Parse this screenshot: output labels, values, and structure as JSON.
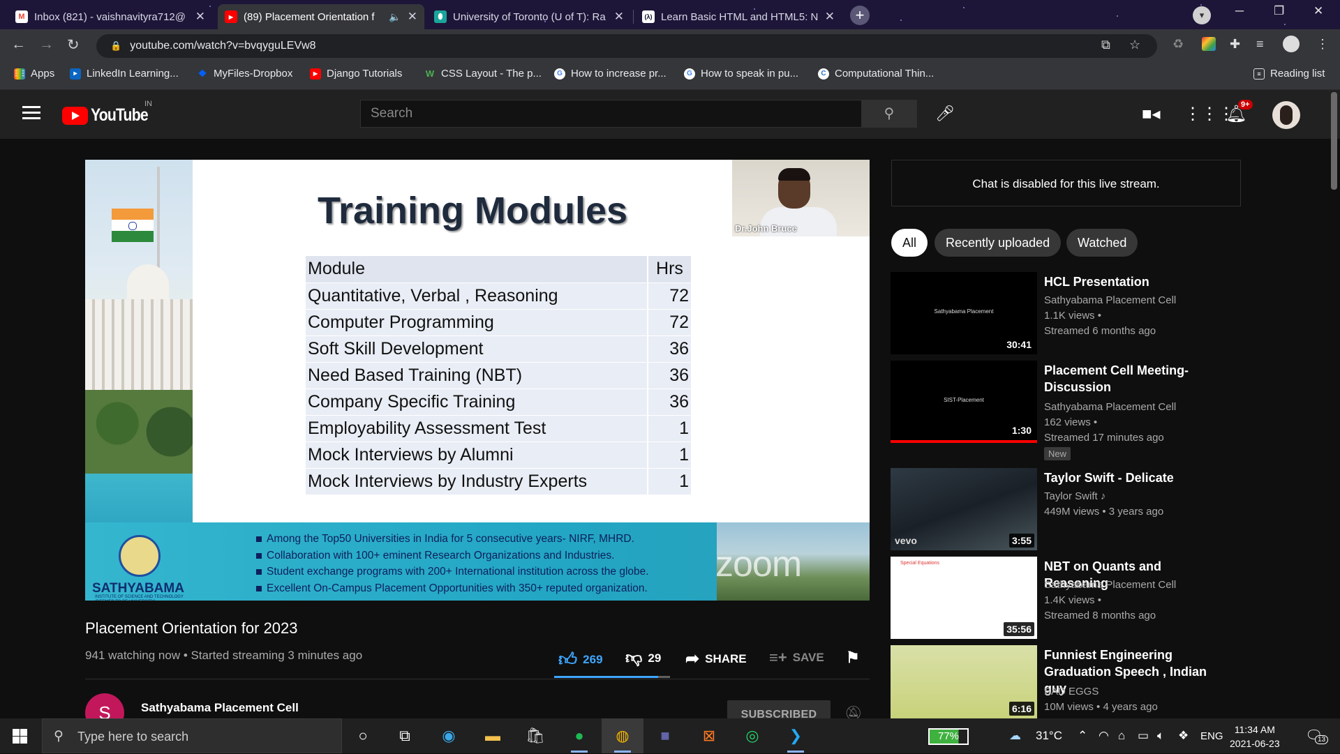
{
  "browser": {
    "tabs": [
      {
        "label": "Inbox (821) - vaishnavityra712@",
        "icon": "gmail-icon"
      },
      {
        "label": "(89) Placement Orientation f",
        "icon": "youtube-icon",
        "active": true
      },
      {
        "label": "University of Toronto (U of T): Ra",
        "icon": "bookmark-icon"
      },
      {
        "label": "Learn Basic HTML and HTML5: N",
        "icon": "fcc-icon"
      }
    ],
    "url": "youtube.com/watch?v=bvqyguLEVw8",
    "bookmarks": [
      {
        "label": "Apps",
        "icon": "apps-grid-icon",
        "color": "#4285f4"
      },
      {
        "label": "LinkedIn Learning...",
        "icon": "linkedin-learning-icon",
        "color": "#0a66c2"
      },
      {
        "label": "MyFiles-Dropbox",
        "icon": "dropbox-icon",
        "color": "#0061fe"
      },
      {
        "label": "Django Tutorials",
        "icon": "youtube-icon",
        "color": "#ff0000"
      },
      {
        "label": "CSS Layout - The p...",
        "icon": "w3-icon",
        "color": "#4caf50"
      },
      {
        "label": "How to increase pr...",
        "icon": "google-icon",
        "color": "#ffffff"
      },
      {
        "label": "How to speak in pu...",
        "icon": "google-icon",
        "color": "#ffffff"
      },
      {
        "label": "Computational Thin...",
        "icon": "coursera-icon",
        "color": "#2a73cc"
      }
    ],
    "reading_list": "Reading list"
  },
  "youtube": {
    "logo_text": "YouTube",
    "country_code": "IN",
    "search_placeholder": "Search",
    "notif_badge": "9+"
  },
  "video": {
    "slide_title": "Training Modules",
    "table_header": {
      "module": "Module",
      "hrs": "Hrs"
    },
    "modules": [
      {
        "name": "Quantitative, Verbal , Reasoning",
        "hrs": "72"
      },
      {
        "name": "Computer Programming",
        "hrs": "72"
      },
      {
        "name": "Soft Skill Development",
        "hrs": "36"
      },
      {
        "name": "Need Based Training (NBT)",
        "hrs": "36"
      },
      {
        "name": "Company Specific Training",
        "hrs": "36"
      },
      {
        "name": "Employability Assessment Test",
        "hrs": "1"
      },
      {
        "name": "Mock Interviews by Alumni",
        "hrs": "1"
      },
      {
        "name": "Mock Interviews by Industry Experts",
        "hrs": "1"
      }
    ],
    "speaker_name": "Dr.John Bruce",
    "institution": "SATHYABAMA",
    "institution_sub": "INSTITUTE OF SCIENCE AND TECHNOLOGY (DEEMED TO BE UNIVERSITY)",
    "bullets": [
      "Among the Top50 Universities in India for 5 consecutive years- NIRF, MHRD.",
      "Collaboration with 100+ eminent Research Organizations and Industries.",
      "Student exchange programs with 200+ International institution across the globe.",
      "Excellent On-Campus Placement Opportunities with 350+ reputed organization."
    ],
    "watermark": "zoom",
    "title": "Placement Orientation for 2023",
    "meta": "941 watching now • Started streaming 3 minutes ago",
    "likes": "269",
    "dislikes": "29",
    "share_label": "SHARE",
    "save_label": "SAVE",
    "like_ratio": 0.9
  },
  "channel": {
    "avatar_letter": "S",
    "name": "Sathyabama Placement Cell",
    "subscribe_label": "SUBSCRIBED"
  },
  "chat": {
    "disabled_text": "Chat is disabled for this live stream."
  },
  "chips": [
    "All",
    "Recently uploaded",
    "Watched"
  ],
  "recommendations": [
    {
      "title": "HCL Presentation",
      "channel": "Sathyabama Placement Cell",
      "views": "1.1K views •",
      "when": "Streamed 6 months ago",
      "duration": "30:41",
      "thumb_text": "Sathyabama Placement"
    },
    {
      "title": "Placement Cell Meeting-Discussion",
      "channel": "Sathyabama Placement Cell",
      "views": "162 views •",
      "when": "Streamed 17 minutes ago",
      "duration": "1:30",
      "thumb_text": "SIST-Placement",
      "badge": "New",
      "watched_progress": 1.0
    },
    {
      "title": "Taylor Swift - Delicate",
      "channel": "Taylor Swift",
      "views": "449M views • 3 years ago",
      "when": "",
      "duration": "3:55",
      "thumb_text": "vevo"
    },
    {
      "title": "NBT on Quants and Reasoning",
      "channel": "Sathyabama Placement Cell",
      "views": "1.4K views •",
      "when": "Streamed 8 months ago",
      "duration": "35:56",
      "thumb_text": "Special Equations"
    },
    {
      "title": "Funniest Engineering Graduation Speech , Indian guy",
      "channel": "BAD EGGS",
      "views": "10M views • 4 years ago",
      "when": "",
      "duration": "6:16",
      "thumb_text": ""
    }
  ],
  "taskbar": {
    "search_placeholder": "Type here to search",
    "battery": "77%",
    "temperature": "31°C",
    "language": "ENG",
    "time": "11:34 AM",
    "date": "2021-06-23",
    "notifications": "13"
  }
}
